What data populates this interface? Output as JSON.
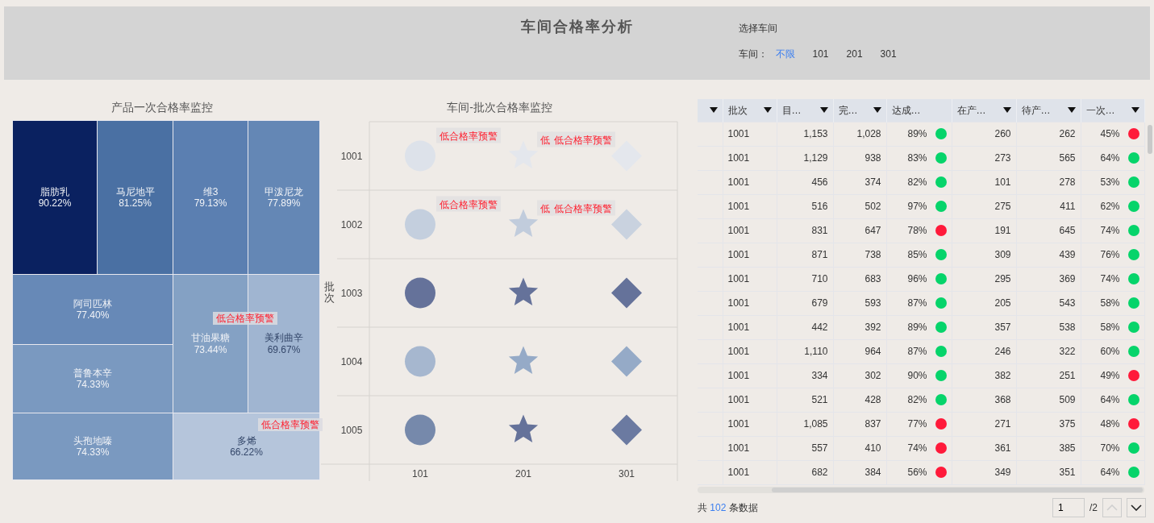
{
  "header": {
    "title": "车间合格率分析",
    "filter": {
      "heading": "选择车间",
      "label": "车间：",
      "options": [
        {
          "label": "不限",
          "selected": true
        },
        {
          "label": "101",
          "selected": false
        },
        {
          "label": "201",
          "selected": false
        },
        {
          "label": "301",
          "selected": false
        }
      ]
    }
  },
  "treemap": {
    "title": "产品一次合格率监控",
    "cells": [
      {
        "name": "脂肪乳",
        "value": "90.22%",
        "color": "#0a2160"
      },
      {
        "name": "马尼地平",
        "value": "81.25%",
        "color": "#4a70a3"
      },
      {
        "name": "维3",
        "value": "79.13%",
        "color": "#5b7fb1"
      },
      {
        "name": "甲泼尼龙",
        "value": "77.89%",
        "color": "#6487b5"
      },
      {
        "name": "阿司匹林",
        "value": "77.40%",
        "color": "#6789b7"
      },
      {
        "name": "普鲁本辛",
        "value": "74.33%",
        "color": "#7a99c0"
      },
      {
        "name": "头孢地嗪",
        "value": "74.33%",
        "color": "#7a99c0"
      },
      {
        "name": "甘油果糖",
        "value": "73.44%",
        "color": "#84a1c4"
      },
      {
        "name": "美利曲辛",
        "value": "69.67%",
        "color": "#a0b5d1",
        "warning": "低合格率预警"
      },
      {
        "name": "多烯",
        "value": "66.22%",
        "color": "#b5c5db",
        "warning": "低合格率预警"
      }
    ]
  },
  "scatter": {
    "title": "车间-批次合格率监控",
    "y_axis_title": "批次",
    "columns": [
      "101",
      "201",
      "301"
    ],
    "rows": [
      {
        "label": "1001",
        "points": [
          {
            "kind": "circle",
            "color": "#dde2ea",
            "warning": "低合格率预警"
          },
          {
            "kind": "star",
            "color": "#e4e7ed",
            "warning": "低"
          },
          {
            "kind": "diamond",
            "color": "#e4e7ed",
            "warning": "低合格率预警"
          }
        ]
      },
      {
        "label": "1002",
        "points": [
          {
            "kind": "circle",
            "color": "#c4cfde",
            "warning": "低合格率预警"
          },
          {
            "kind": "star",
            "color": "#c1ccdc",
            "warning": "低"
          },
          {
            "kind": "diamond",
            "color": "#c9d2df",
            "warning": "低合格率预警"
          }
        ]
      },
      {
        "label": "1003",
        "points": [
          {
            "kind": "circle",
            "color": "#65729a"
          },
          {
            "kind": "star",
            "color": "#65729a"
          },
          {
            "kind": "diamond",
            "color": "#65729a"
          }
        ]
      },
      {
        "label": "1004",
        "points": [
          {
            "kind": "circle",
            "color": "#a6b7cf"
          },
          {
            "kind": "star",
            "color": "#95aac7"
          },
          {
            "kind": "diamond",
            "color": "#95aac7"
          }
        ]
      },
      {
        "label": "1005",
        "points": [
          {
            "kind": "circle",
            "color": "#7689ab"
          },
          {
            "kind": "star",
            "color": "#65729a"
          },
          {
            "kind": "diamond",
            "color": "#6b7aa1"
          }
        ]
      }
    ]
  },
  "table": {
    "columns": [
      {
        "filter": true
      },
      {
        "label": "批次",
        "filter": true
      },
      {
        "label": "目…",
        "filter": true
      },
      {
        "label": "完…",
        "filter": true
      },
      {
        "label": "达成…",
        "filter": false
      },
      {
        "label": "在产…",
        "filter": true
      },
      {
        "label": "待产…",
        "filter": true
      },
      {
        "label": "一次…",
        "filter": true
      }
    ],
    "rows": [
      {
        "batch": "1001",
        "target": "1,153",
        "done": "1,028",
        "reach": {
          "text": "89%",
          "color": "#06d46a"
        },
        "wip": "260",
        "pending": "262",
        "first": {
          "text": "45%",
          "color": "#ff1a3a"
        }
      },
      {
        "batch": "1001",
        "target": "1,129",
        "done": "938",
        "reach": {
          "text": "83%",
          "color": "#06d46a"
        },
        "wip": "273",
        "pending": "565",
        "first": {
          "text": "64%",
          "color": "#06d46a"
        }
      },
      {
        "batch": "1001",
        "target": "456",
        "done": "374",
        "reach": {
          "text": "82%",
          "color": "#06d46a"
        },
        "wip": "101",
        "pending": "278",
        "first": {
          "text": "53%",
          "color": "#06d46a"
        }
      },
      {
        "batch": "1001",
        "target": "516",
        "done": "502",
        "reach": {
          "text": "97%",
          "color": "#06d46a"
        },
        "wip": "275",
        "pending": "411",
        "first": {
          "text": "62%",
          "color": "#06d46a"
        }
      },
      {
        "batch": "1001",
        "target": "831",
        "done": "647",
        "reach": {
          "text": "78%",
          "color": "#ff1a3a"
        },
        "wip": "191",
        "pending": "645",
        "first": {
          "text": "74%",
          "color": "#06d46a"
        }
      },
      {
        "batch": "1001",
        "target": "871",
        "done": "738",
        "reach": {
          "text": "85%",
          "color": "#06d46a"
        },
        "wip": "309",
        "pending": "439",
        "first": {
          "text": "76%",
          "color": "#06d46a"
        }
      },
      {
        "batch": "1001",
        "target": "710",
        "done": "683",
        "reach": {
          "text": "96%",
          "color": "#06d46a"
        },
        "wip": "295",
        "pending": "369",
        "first": {
          "text": "74%",
          "color": "#06d46a"
        }
      },
      {
        "batch": "1001",
        "target": "679",
        "done": "593",
        "reach": {
          "text": "87%",
          "color": "#06d46a"
        },
        "wip": "205",
        "pending": "543",
        "first": {
          "text": "58%",
          "color": "#06d46a"
        }
      },
      {
        "batch": "1001",
        "target": "442",
        "done": "392",
        "reach": {
          "text": "89%",
          "color": "#06d46a"
        },
        "wip": "357",
        "pending": "538",
        "first": {
          "text": "58%",
          "color": "#06d46a"
        }
      },
      {
        "batch": "1001",
        "target": "1,110",
        "done": "964",
        "reach": {
          "text": "87%",
          "color": "#06d46a"
        },
        "wip": "246",
        "pending": "322",
        "first": {
          "text": "60%",
          "color": "#06d46a"
        }
      },
      {
        "batch": "1001",
        "target": "334",
        "done": "302",
        "reach": {
          "text": "90%",
          "color": "#06d46a"
        },
        "wip": "382",
        "pending": "251",
        "first": {
          "text": "49%",
          "color": "#ff1a3a"
        }
      },
      {
        "batch": "1001",
        "target": "521",
        "done": "428",
        "reach": {
          "text": "82%",
          "color": "#06d46a"
        },
        "wip": "368",
        "pending": "509",
        "first": {
          "text": "64%",
          "color": "#06d46a"
        }
      },
      {
        "batch": "1001",
        "target": "1,085",
        "done": "837",
        "reach": {
          "text": "77%",
          "color": "#ff1a3a"
        },
        "wip": "271",
        "pending": "375",
        "first": {
          "text": "48%",
          "color": "#ff1a3a"
        }
      },
      {
        "batch": "1001",
        "target": "557",
        "done": "410",
        "reach": {
          "text": "74%",
          "color": "#ff1a3a"
        },
        "wip": "361",
        "pending": "385",
        "first": {
          "text": "70%",
          "color": "#06d46a"
        }
      },
      {
        "batch": "1001",
        "target": "682",
        "done": "384",
        "reach": {
          "text": "56%",
          "color": "#ff1a3a"
        },
        "wip": "349",
        "pending": "351",
        "first": {
          "text": "64%",
          "color": "#06d46a"
        }
      }
    ],
    "footer": {
      "total_prefix": "共",
      "total": "102",
      "total_suffix": "条数据",
      "page": "1",
      "pages": "/2",
      "prev_disabled": true,
      "next_disabled": false
    }
  }
}
